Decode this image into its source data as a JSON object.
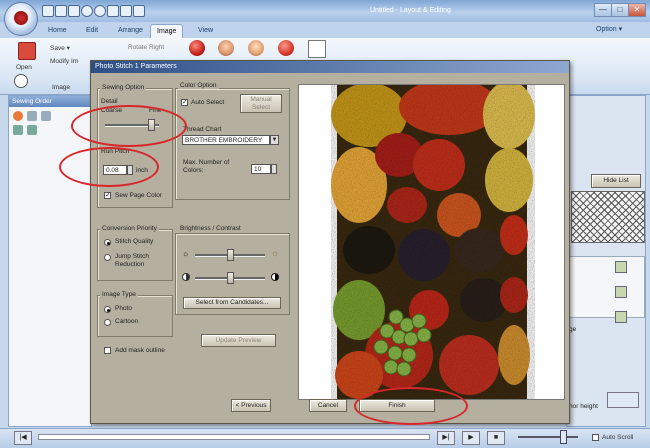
{
  "window": {
    "title": "Untitled - Layout & Editing",
    "controls": [
      "—",
      "□",
      "✕"
    ]
  },
  "tabs": [
    {
      "label": "Home"
    },
    {
      "label": "Edit"
    },
    {
      "label": "Arrange"
    },
    {
      "label": "Image"
    },
    {
      "label": "View"
    }
  ],
  "active_tab": "Image",
  "help_menu": "Option ▾",
  "ribbon": {
    "open_label": "Open",
    "save_label": "Save ▾",
    "modify_label": "Modify Im",
    "rotate_label": "Rotate Right",
    "group_label": "Image"
  },
  "left_panel": {
    "title": "Sewing Order"
  },
  "dialog": {
    "title": "Photo Stitch 1 Parameters",
    "sewing_option": {
      "label": "Sewing Option",
      "detail_label": "Detail",
      "coarse_label": "Coarse",
      "fine_label": "Fine",
      "detail_level": 0.85,
      "run_pitch_label": "Run Pitch",
      "run_pitch_value": "0.08",
      "run_pitch_unit": "inch",
      "sew_page_color_label": "Sew Page Color",
      "sew_page_color_checked": true
    },
    "conversion_priority": {
      "label": "Conversion Priority",
      "options": [
        {
          "label": "Stitch Quality",
          "selected": true
        },
        {
          "label": "Jump Stitch\nReduction",
          "selected": false
        }
      ]
    },
    "image_type": {
      "label": "Image Type",
      "options": [
        {
          "label": "Photo",
          "selected": true
        },
        {
          "label": "Cartoon",
          "selected": false
        }
      ]
    },
    "add_mask_outline_label": "Add mask outline",
    "color_option": {
      "label": "Color Option",
      "auto_select_label": "Auto Select",
      "auto_select_checked": true,
      "manual_select_label": "Manual\nSelect",
      "thread_chart_label": "Thread Chart",
      "thread_chart_value": "BROTHER EMBROIDERY",
      "max_colors_label": "Max. Number of\nColors:",
      "max_colors_value": "10"
    },
    "brightness_contrast": {
      "label": "Brightness / Contrast",
      "brightness_level": 0.5,
      "contrast_level": 0.5
    },
    "select_candidates_label": "Select from Candidates...",
    "update_preview_label": "Update Preview",
    "buttons": {
      "previous": "< Previous",
      "cancel": "Cancel",
      "finish": "Finish"
    }
  },
  "right_panel": {
    "hide_list_label": "Hide List",
    "partial_labels": [
      "ge",
      "hor height"
    ]
  },
  "status": {
    "auto_scroll_label": "Auto Scroll"
  },
  "colors": {
    "annotation_red": "#d8262a",
    "dialog_bg": "#b4af9e",
    "ribbon_blue": "#c9d9ec"
  }
}
